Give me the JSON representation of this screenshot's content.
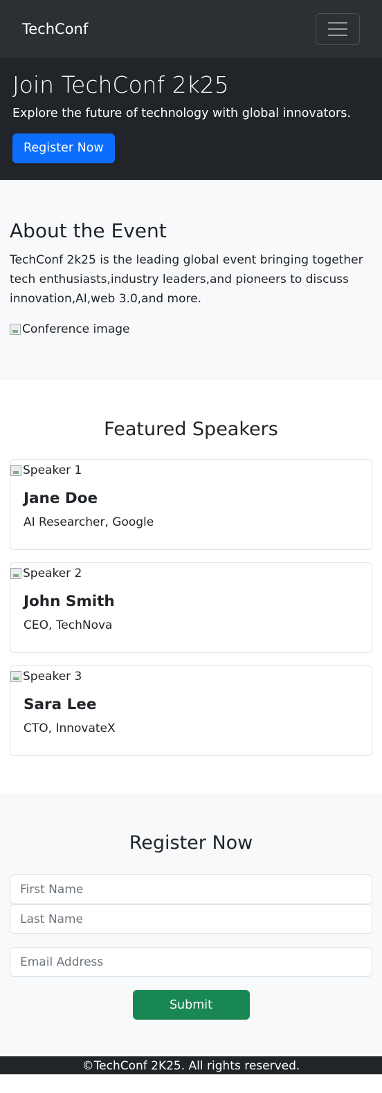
{
  "navbar": {
    "brand": "TechConf"
  },
  "hero": {
    "title": "Join TechConf 2k25",
    "subtitle": "Explore the future of technology with global innovators.",
    "cta_label": "Register Now"
  },
  "about": {
    "heading": "About the Event",
    "text": "TechConf 2k25 is the leading global event bringing together tech enthusiasts,industry leaders,and pioneers to discuss innovation,AI,web 3.0,and more.",
    "image_alt": "Conference image"
  },
  "speakers": {
    "heading": "Featured Speakers",
    "items": [
      {
        "image_alt": "Speaker 1",
        "name": "Jane Doe",
        "role": "AI Researcher, Google"
      },
      {
        "image_alt": "Speaker 2",
        "name": "John Smith",
        "role": "CEO, TechNova"
      },
      {
        "image_alt": "Speaker 3",
        "name": "Sara Lee",
        "role": "CTO, InnovateX"
      }
    ]
  },
  "register": {
    "heading": "Register Now",
    "first_name_placeholder": "First Name",
    "last_name_placeholder": "Last Name",
    "email_placeholder": "Email Address",
    "submit_label": "Submit"
  },
  "footer": {
    "text": "©TechConf 2K25. All rights reserved."
  },
  "colors": {
    "navbar_bg": "#2b3035",
    "hero_bg": "#212529",
    "primary": "#0d6efd",
    "success": "#198754",
    "light_bg": "#f8f9fa"
  },
  "icons": {
    "menu": "hamburger-menu-icon",
    "broken_image": "broken-image-icon"
  }
}
